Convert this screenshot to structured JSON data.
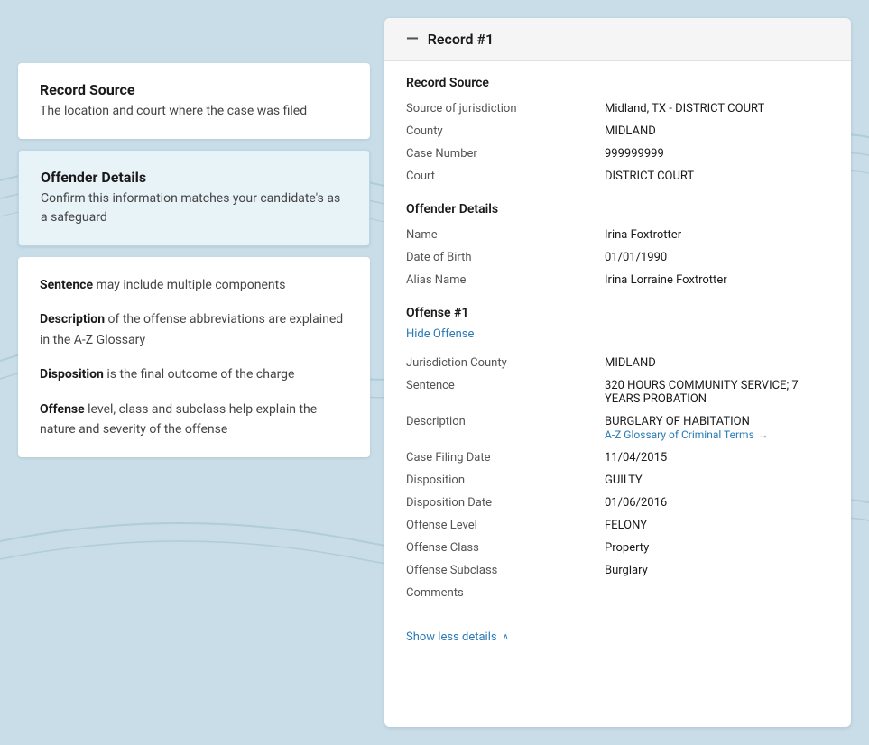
{
  "left_panel": {
    "card1": {
      "title": "Record Source",
      "description": "The location and court where the case was filed"
    },
    "card2": {
      "title": "Offender Details",
      "description": "Confirm this information matches your candidate's as a safeguard"
    },
    "card3": {
      "sections": [
        {
          "label": "Sentence",
          "text": " may include multiple components"
        },
        {
          "label": "Description",
          "text": " of the offense abbreviations are explained in the A-Z Glossary"
        },
        {
          "label": "Disposition",
          "text": " is the final outcome of the charge"
        },
        {
          "label": "Offense",
          "text": " level, class and subclass help explain the nature and severity of the offense"
        }
      ]
    }
  },
  "right_panel": {
    "header": {
      "dash": "—",
      "title": "Record #1"
    },
    "record_source": {
      "section_title": "Record Source",
      "fields": [
        {
          "label": "Source of jurisdiction",
          "value": "Midland, TX - DISTRICT COURT"
        },
        {
          "label": "County",
          "value": "MIDLAND"
        },
        {
          "label": "Case Number",
          "value": "999999999"
        },
        {
          "label": "Court",
          "value": "DISTRICT COURT"
        }
      ]
    },
    "offender_details": {
      "section_title": "Offender Details",
      "fields": [
        {
          "label": "Name",
          "value": "Irina Foxtrotter"
        },
        {
          "label": "Date of Birth",
          "value": "01/01/1990"
        },
        {
          "label": "Alias Name",
          "value": "Irina Lorraine Foxtrotter"
        }
      ]
    },
    "offense": {
      "title": "Offense #1",
      "hide_label": "Hide Offense",
      "fields": [
        {
          "label": "Jurisdiction County",
          "value": "MIDLAND"
        },
        {
          "label": "Sentence",
          "value": "320 HOURS COMMUNITY SERVICE; 7 YEARS PROBATION"
        },
        {
          "label": "Description",
          "value": "BURGLARY OF HABITATION",
          "has_link": true
        },
        {
          "label": "Case Filing Date",
          "value": "11/04/2015"
        },
        {
          "label": "Disposition",
          "value": "GUILTY"
        },
        {
          "label": "Disposition Date",
          "value": "01/06/2016"
        },
        {
          "label": "Offense Level",
          "value": "FELONY"
        },
        {
          "label": "Offense Class",
          "value": "Property"
        },
        {
          "label": "Offense Subclass",
          "value": "Burglary"
        },
        {
          "label": "Comments",
          "value": ""
        }
      ],
      "glossary_link": "A-Z Glossary of Criminal Terms",
      "glossary_arrow": "→"
    },
    "show_less": "Show less details"
  }
}
